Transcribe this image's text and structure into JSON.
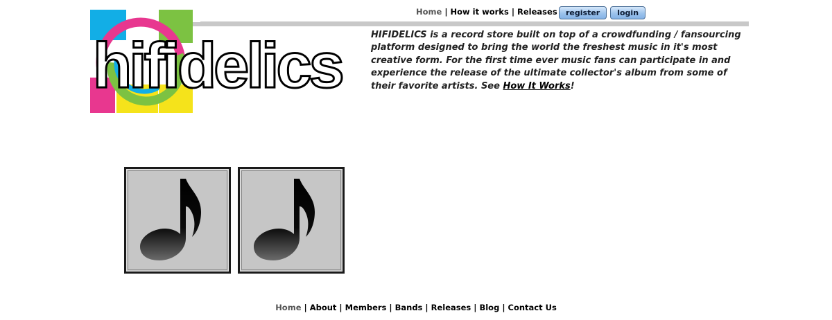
{
  "brand": {
    "logo_text": "hifidelics"
  },
  "top_nav": {
    "links": [
      "Home",
      "How it works",
      "Releases"
    ],
    "separator": "|",
    "register_label": "register",
    "login_label": "login"
  },
  "intro": {
    "text": "HIFIDELICS is a record store built on top of a crowdfunding / fansourcing platform designed to bring the world the freshest music in it's most creative form. For the first time ever music fans can participate in and experience the release of the ultimate collector's album from some of their favorite artists. See ",
    "link_text": "How It Works",
    "trailing": "!"
  },
  "releases": [
    {
      "icon": "music-note-icon"
    },
    {
      "icon": "music-note-icon"
    }
  ],
  "footer": {
    "links": [
      "Home",
      "About",
      "Members",
      "Bands",
      "Releases",
      "Blog",
      "Contact Us"
    ],
    "separator": "|"
  },
  "colors": {
    "logo_cyan": "#12aee6",
    "logo_magenta": "#e8378f",
    "logo_yellow": "#f5e31b",
    "logo_green": "#7cc242",
    "button_blue": "#9cc3ec",
    "bar_grey": "#c8c8c8",
    "tile_grey": "#c6c6c6"
  }
}
